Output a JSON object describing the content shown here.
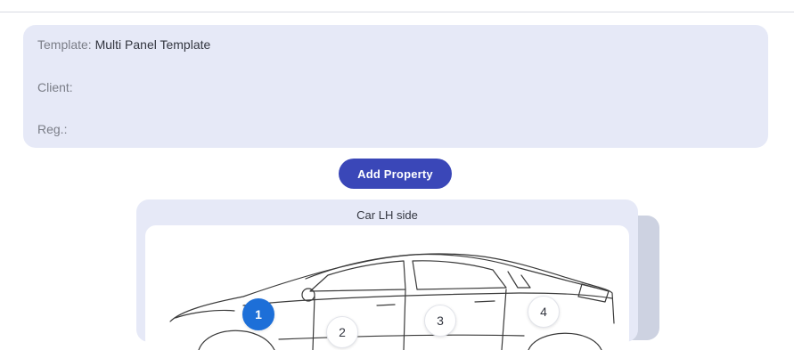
{
  "info": {
    "template_label": "Template:",
    "template_value": "Multi Panel Template",
    "client_label": "Client:",
    "client_value": "",
    "reg_label": "Reg.:",
    "reg_value": ""
  },
  "actions": {
    "add_property_label": "Add Property"
  },
  "panel": {
    "title": "Car LH side",
    "markers": [
      {
        "label": "1",
        "active": true
      },
      {
        "label": "2",
        "active": false
      },
      {
        "label": "3",
        "active": false
      },
      {
        "label": "4",
        "active": false
      }
    ]
  },
  "colors": {
    "card_bg": "#e6e9f7",
    "button_bg": "#3a47b8",
    "active_marker": "#1d6fd8"
  },
  "icons": {
    "car": "car-side-outline-icon"
  }
}
